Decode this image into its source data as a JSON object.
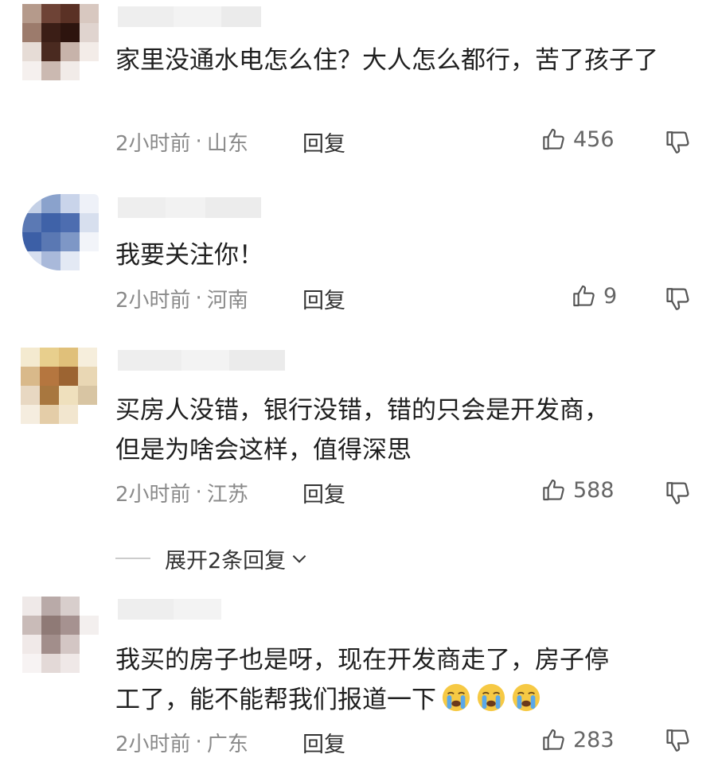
{
  "comments": [
    {
      "text": "家里没通水电怎么住？大人怎么都行，苦了孩子了",
      "time": "2小时前",
      "location": "山东",
      "reply_label": "回复",
      "likes": "456",
      "avatar_colors": [
        "#b59a8b",
        "#6e4336",
        "#5a3125",
        "#d8c8c0",
        "#9c7b6c",
        "#3b1e16",
        "#2d140e",
        "#e0d4cf",
        "#e6dcd6",
        "#4a2a20",
        "#c7b3aa",
        "#f3ece8",
        "#f5f0ee",
        "#cbb9b1",
        "#f1ebe8",
        "#ffffff"
      ]
    },
    {
      "text": "我要关注你！",
      "time": "2小时前",
      "location": "河南",
      "reply_label": "回复",
      "likes": "9",
      "avatar_colors": [
        "#c4d0e6",
        "#8aa2cc",
        "#c9d4ea",
        "#eef1f8",
        "#5b79b4",
        "#3f62a8",
        "#4d6db0",
        "#d7dfee",
        "#3c5fa6",
        "#5a78b3",
        "#7e97c6",
        "#f2f4f9",
        "#d7dff0",
        "#a9b9da",
        "#e3e9f4",
        "#ffffff"
      ]
    },
    {
      "text": "买房人没错，银行没错，错的只会是开发商，\n但是为啥会这样，值得深思",
      "time": "2小时前",
      "location": "江苏",
      "reply_label": "回复",
      "likes": "588",
      "avatar_colors": [
        "#f4ead0",
        "#e8cf8d",
        "#e0c07a",
        "#f6eedc",
        "#d9b98a",
        "#b5763f",
        "#9c6432",
        "#e9d7b4",
        "#e8d8c2",
        "#a8773f",
        "#efe0bd",
        "#d8c5a3",
        "#f5eddf",
        "#e4cda8",
        "#f2e6cf",
        "#ffffff"
      ]
    },
    {
      "text": "我买的房子也是呀，现在开发商走了，房子停\n工了，能不能帮我们报道一下",
      "time": "2小时前",
      "location": "广东",
      "reply_label": "回复",
      "likes": "283",
      "emoji_count": 3,
      "avatar_colors": [
        "#efe9e8",
        "#b9aaa8",
        "#d8cecc",
        "#ffffff",
        "#c9bbb8",
        "#8f7a76",
        "#a69290",
        "#f3efee",
        "#f0e9e8",
        "#a28e8b",
        "#d3c6c4",
        "#ffffff",
        "#f7f3f3",
        "#e3d9d7",
        "#efe8e7",
        "#ffffff"
      ]
    }
  ],
  "expand_replies": {
    "label": "展开2条回复"
  },
  "separator": "·",
  "colors": {
    "text": "#1f1f1f",
    "meta": "#8a8a8a",
    "emoji_face": "#f6c944",
    "emoji_tear": "#5aa8e8"
  }
}
